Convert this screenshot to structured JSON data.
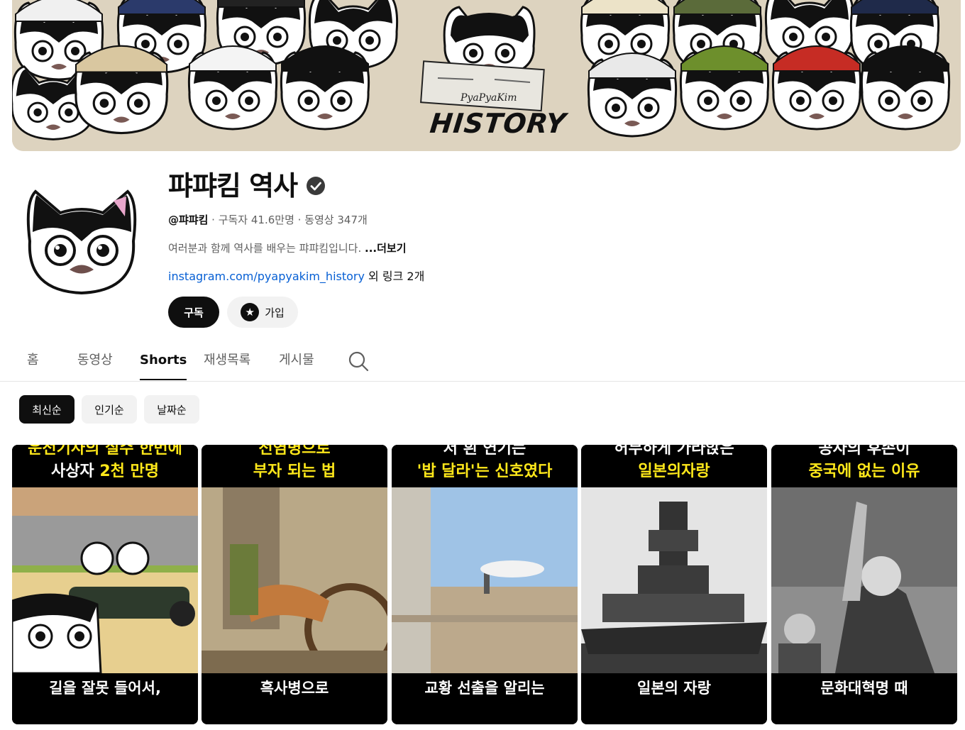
{
  "banner": {
    "logo_text": "HISTORY",
    "logo_sub": "PyaPyaKim"
  },
  "channel": {
    "name": "퍄퍄킴 역사",
    "handle": "@퍄퍄킴",
    "subscribers": " · 구독자 41.6만명",
    "videos": " · 동영상 347개",
    "description": "여러분과 함께 역사를 배우는 퍄퍄킴입니다. ",
    "more_label": "...더보기",
    "link": "instagram.com/pyapyakim_history",
    "link_extra": " 외 링크 2개",
    "subscribe_label": "구독",
    "join_label": "가입"
  },
  "tabs": [
    {
      "label": "홈"
    },
    {
      "label": "동영상"
    },
    {
      "label": "Shorts"
    },
    {
      "label": "재생목록"
    },
    {
      "label": "게시물"
    }
  ],
  "active_tab": "Shorts",
  "sort_chips": [
    {
      "label": "최신순"
    },
    {
      "label": "인기순"
    },
    {
      "label": "날짜순"
    }
  ],
  "shorts": [
    {
      "title_line1": "운전기사의 실수 한번에",
      "title_line2_a": "사상자 ",
      "title_line2_y": "2천 만명",
      "caption": "길을 잘못 들어서,"
    },
    {
      "title_line1": "전염병으로",
      "title_line2_a": "",
      "title_line2_y": "부자 되는 법",
      "caption": "흑사병으로"
    },
    {
      "title_line1": "저 흰 연기는",
      "title_line2_a": "",
      "title_line2_y": "'밥 달라'는 신호였다",
      "caption": "교황 선출을 알리는"
    },
    {
      "title_line1": "허무하게 가라앉은",
      "title_line2_a": "",
      "title_line2_y": "일본의자랑",
      "caption": "일본의 자랑"
    },
    {
      "title_line1": "공자의 후손이",
      "title_line2_a": "",
      "title_line2_y": "중국에 없는 이유",
      "caption": "문화대혁명 때"
    }
  ],
  "colors": {
    "accent_yellow": "#ffe81a",
    "link_blue": "#065fd4",
    "text_primary": "#0f0f0f",
    "text_secondary": "#606060"
  }
}
